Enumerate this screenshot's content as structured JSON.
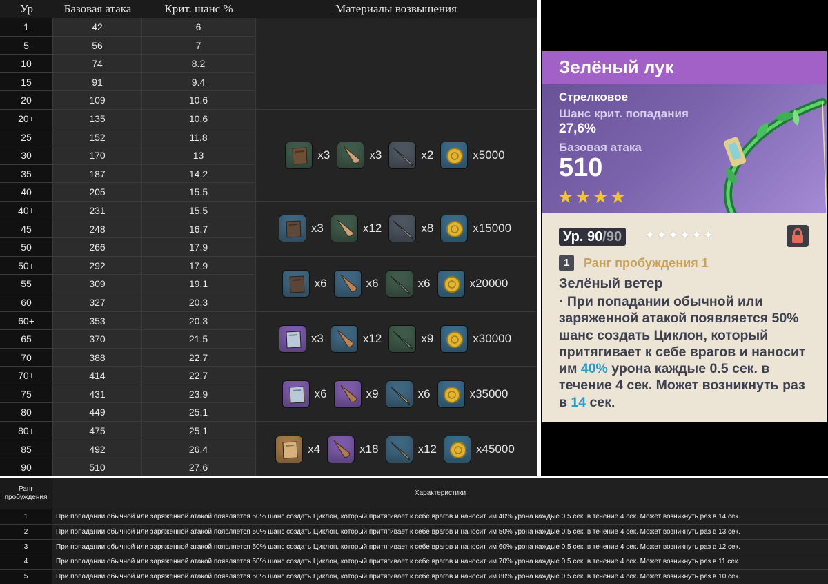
{
  "stats_table": {
    "headers": {
      "level": "Ур",
      "base_atk": "Базовая атака",
      "crit": "Крит. шанс %",
      "materials": "Материалы возвышения"
    },
    "rows": [
      {
        "level": "1",
        "atk": "42",
        "crit": "6"
      },
      {
        "level": "5",
        "atk": "56",
        "crit": "7"
      },
      {
        "level": "10",
        "atk": "74",
        "crit": "8.2"
      },
      {
        "level": "15",
        "atk": "91",
        "crit": "9.4"
      },
      {
        "level": "20",
        "atk": "109",
        "crit": "10.6"
      },
      {
        "level": "20+",
        "atk": "135",
        "crit": "10.6"
      },
      {
        "level": "25",
        "atk": "152",
        "crit": "11.8"
      },
      {
        "level": "30",
        "atk": "170",
        "crit": "13"
      },
      {
        "level": "35",
        "atk": "187",
        "crit": "14.2"
      },
      {
        "level": "40",
        "atk": "205",
        "crit": "15.5"
      },
      {
        "level": "40+",
        "atk": "231",
        "crit": "15.5"
      },
      {
        "level": "45",
        "atk": "248",
        "crit": "16.7"
      },
      {
        "level": "50",
        "atk": "266",
        "crit": "17.9"
      },
      {
        "level": "50+",
        "atk": "292",
        "crit": "17.9"
      },
      {
        "level": "55",
        "atk": "309",
        "crit": "19.1"
      },
      {
        "level": "60",
        "atk": "327",
        "crit": "20.3"
      },
      {
        "level": "60+",
        "atk": "353",
        "crit": "20.3"
      },
      {
        "level": "65",
        "atk": "370",
        "crit": "21.5"
      },
      {
        "level": "70",
        "atk": "388",
        "crit": "22.7"
      },
      {
        "level": "70+",
        "atk": "414",
        "crit": "22.7"
      },
      {
        "level": "75",
        "atk": "431",
        "crit": "23.9"
      },
      {
        "level": "80",
        "atk": "449",
        "crit": "25.1"
      },
      {
        "level": "80+",
        "atk": "475",
        "crit": "25.1"
      },
      {
        "level": "85",
        "atk": "492",
        "crit": "26.4"
      },
      {
        "level": "90",
        "atk": "510",
        "crit": "27.6"
      }
    ],
    "material_groups": [
      {
        "rows": 5,
        "items": []
      },
      {
        "rows": 5,
        "items": [
          {
            "icon": "domain-material-icon",
            "color": "#6d4f35",
            "bg": "#3f5a4a",
            "count": "x3"
          },
          {
            "icon": "horn-material-icon",
            "color": "#c9a27a",
            "bg": "#3f5a4a",
            "count": "x3"
          },
          {
            "icon": "arrowhead-material-icon",
            "color": "#8f8f8f",
            "bg": "#4d5560",
            "count": "x2"
          },
          {
            "icon": "mora-coin-icon",
            "color": "#e3b431",
            "bg": "#3a6a88",
            "count": "x5000"
          }
        ]
      },
      {
        "rows": 3,
        "items": [
          {
            "icon": "domain-material-icon",
            "color": "#5f4a3a",
            "bg": "#3f6680",
            "count": "x3"
          },
          {
            "icon": "horn-material-icon",
            "color": "#c9a27a",
            "bg": "#3f5a4a",
            "count": "x12"
          },
          {
            "icon": "arrowhead-material-icon",
            "color": "#8f8f8f",
            "bg": "#4d5560",
            "count": "x8"
          },
          {
            "icon": "mora-coin-icon",
            "color": "#e3b431",
            "bg": "#3a6a88",
            "count": "x15000"
          }
        ]
      },
      {
        "rows": 3,
        "items": [
          {
            "icon": "domain-material-icon",
            "color": "#5a4638",
            "bg": "#3f6680",
            "count": "x6"
          },
          {
            "icon": "horn-material-icon",
            "color": "#b88458",
            "bg": "#3f6680",
            "count": "x6"
          },
          {
            "icon": "arrowhead-material-icon",
            "color": "#7d8a86",
            "bg": "#3f5a4a",
            "count": "x6"
          },
          {
            "icon": "mora-coin-icon",
            "color": "#e3b431",
            "bg": "#3a6a88",
            "count": "x20000"
          }
        ]
      },
      {
        "rows": 3,
        "items": [
          {
            "icon": "domain-material-icon",
            "color": "#b9c9d6",
            "bg": "#7b5aa8",
            "count": "x3"
          },
          {
            "icon": "horn-material-icon",
            "color": "#b88458",
            "bg": "#3f6680",
            "count": "x12"
          },
          {
            "icon": "arrowhead-material-icon",
            "color": "#6f8a7a",
            "bg": "#3f5a4a",
            "count": "x9"
          },
          {
            "icon": "mora-coin-icon",
            "color": "#e3b431",
            "bg": "#3a6a88",
            "count": "x30000"
          }
        ]
      },
      {
        "rows": 3,
        "items": [
          {
            "icon": "domain-material-icon",
            "color": "#b9c9d6",
            "bg": "#7b5aa8",
            "count": "x6"
          },
          {
            "icon": "horn-material-icon",
            "color": "#b07a52",
            "bg": "#7b5aa8",
            "count": "x9"
          },
          {
            "icon": "arrowhead-material-icon",
            "color": "#c9a85a",
            "bg": "#3f6680",
            "count": "x6"
          },
          {
            "icon": "mora-coin-icon",
            "color": "#e3b431",
            "bg": "#3a6a88",
            "count": "x35000"
          }
        ]
      },
      {
        "rows": 3,
        "items": [
          {
            "icon": "domain-material-icon",
            "color": "#d9b07a",
            "bg": "#a57a46",
            "count": "x4"
          },
          {
            "icon": "horn-material-icon",
            "color": "#b07a52",
            "bg": "#7b5aa8",
            "count": "x18"
          },
          {
            "icon": "arrowhead-material-icon",
            "color": "#a88f5a",
            "bg": "#3f6680",
            "count": "x12"
          },
          {
            "icon": "mora-coin-icon",
            "color": "#e3b431",
            "bg": "#3a6a88",
            "count": "x45000"
          }
        ]
      }
    ]
  },
  "card": {
    "name": "Зелёный лук",
    "type": "Стрелковое",
    "crit_label": "Шанс крит. попадания",
    "crit_value": "27,6%",
    "atk_label": "Базовая атака",
    "atk_value": "510",
    "stars": "★★★★",
    "level_label": "Ур. 90",
    "level_max": "/90",
    "ascension_stars": "✦✦✦✦✦✦",
    "refine_num": "1",
    "refine_label": "Ранг пробуждения 1",
    "effect_title": "Зелёный ветер",
    "effect_desc": {
      "p1": "· При попадании обычной или заряженной атакой появляется 50% шанс создать Циклон, который притягивает к себе врагов и наносит им ",
      "hl1": "40%",
      "p2": " урона каждые 0.5 сек. в течение 4 сек. Может возникнуть раз в ",
      "hl2": "14",
      "p3": " сек."
    },
    "colors": {
      "title_bar": "#a261c6",
      "rarity_star": "#f5c531",
      "highlight": "#2f99c6",
      "refine_label": "#c9a25a"
    }
  },
  "refinement_table": {
    "header_rank": "Ранг пробуждения",
    "header_desc": "Характеристики",
    "rows": [
      {
        "rank": "1",
        "text": "При попадании обычной или заряженной атакой появляется 50% шанс создать Циклон, который притягивает к себе врагов и наносит им 40% урона каждые 0.5 сек. в течение 4 сек. Может возникнуть раз в 14 сек."
      },
      {
        "rank": "2",
        "text": "При попадании обычной или заряженной атакой появляется 50% шанс создать Циклон, который притягивает к себе врагов и наносит им 50% урона каждые 0.5 сек. в течение 4 сек. Может возникнуть раз в 13 сек."
      },
      {
        "rank": "3",
        "text": "При попадании обычной или заряженной атакой появляется 50% шанс создать Циклон, который притягивает к себе врагов и наносит им 60% урона каждые 0.5 сек. в течение 4 сек. Может возникнуть раз в 12 сек."
      },
      {
        "rank": "4",
        "text": "При попадании обычной или заряженной атакой появляется 50% шанс создать Циклон, который притягивает к себе врагов и наносит им 70% урона каждые 0.5 сек. в течение 4 сек. Может возникнуть раз в 11 сек."
      },
      {
        "rank": "5",
        "text": "При попадании обычной или заряженной атакой появляется 50% шанс создать Циклон, который притягивает к себе врагов и наносит им 80% урона каждые 0.5 сек. в течение 4 сек. Может возникнуть раз в 10 сек."
      }
    ]
  }
}
